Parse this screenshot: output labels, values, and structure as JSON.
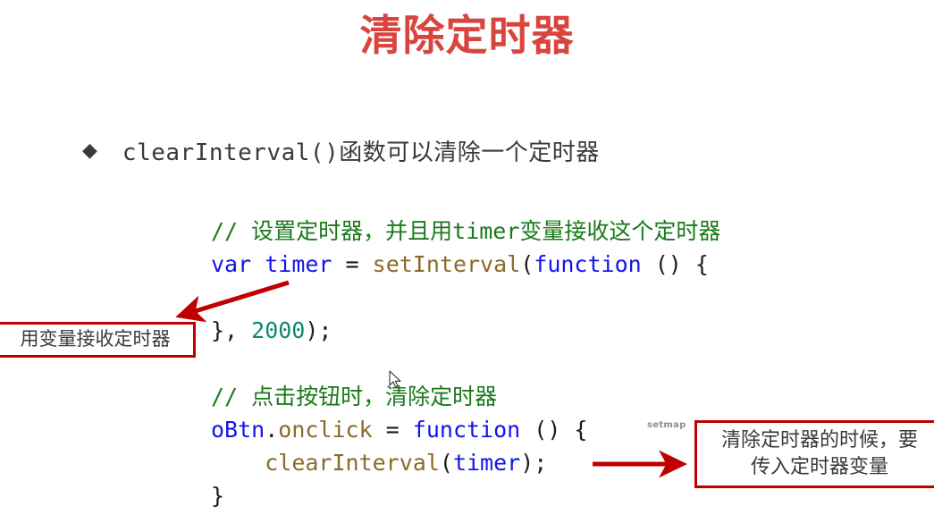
{
  "slide": {
    "title": "清除定时器",
    "title_color": "#d8453f",
    "background": "#ffffff"
  },
  "bullet": {
    "marker": "◆",
    "text": "clearInterval()函数可以清除一个定时器"
  },
  "code": {
    "lines": [
      {
        "id": "l1",
        "tokens": [
          {
            "text": "// 设置定时器，并且用timer变量接收这个定时器",
            "type": "comment"
          }
        ]
      },
      {
        "id": "l2",
        "tokens": [
          {
            "text": "var",
            "type": "keyword"
          },
          {
            "text": " ",
            "type": "plain"
          },
          {
            "text": "timer",
            "type": "var"
          },
          {
            "text": " = ",
            "type": "plain"
          },
          {
            "text": "setInterval",
            "type": "func"
          },
          {
            "text": "(",
            "type": "plain"
          },
          {
            "text": "function",
            "type": "keyword"
          },
          {
            "text": " () {",
            "type": "plain"
          }
        ]
      },
      {
        "id": "l3",
        "tokens": []
      },
      {
        "id": "l4",
        "tokens": [
          {
            "text": "}, ",
            "type": "plain"
          },
          {
            "text": "2000",
            "type": "num"
          },
          {
            "text": ");",
            "type": "plain"
          }
        ]
      },
      {
        "id": "l5",
        "tokens": []
      },
      {
        "id": "l6",
        "tokens": [
          {
            "text": "// 点击按钮时，清除定时器",
            "type": "comment"
          }
        ]
      },
      {
        "id": "l7",
        "tokens": [
          {
            "text": "oBtn",
            "type": "var"
          },
          {
            "text": ".",
            "type": "plain"
          },
          {
            "text": "onclick",
            "type": "prop"
          },
          {
            "text": " = ",
            "type": "plain"
          },
          {
            "text": "function",
            "type": "keyword"
          },
          {
            "text": " () {",
            "type": "plain"
          }
        ]
      },
      {
        "id": "l8",
        "tokens": [
          {
            "text": "    ",
            "type": "plain"
          },
          {
            "text": "clearInterval",
            "type": "func"
          },
          {
            "text": "(",
            "type": "plain"
          },
          {
            "text": "timer",
            "type": "var"
          },
          {
            "text": ");",
            "type": "plain"
          }
        ]
      },
      {
        "id": "l9",
        "tokens": [
          {
            "text": "}",
            "type": "plain"
          }
        ]
      }
    ]
  },
  "annotations": {
    "left_box": {
      "text": "用变量接收定时器",
      "border_color": "#c00000"
    },
    "right_box": {
      "line1": "清除定时器的时候，要",
      "line2": "传入定时器变量",
      "border_color": "#c00000"
    },
    "arrow_color": "#c00000"
  },
  "watermark": {
    "text": "setmap"
  },
  "cursor": {
    "name": "mouse-pointer"
  }
}
